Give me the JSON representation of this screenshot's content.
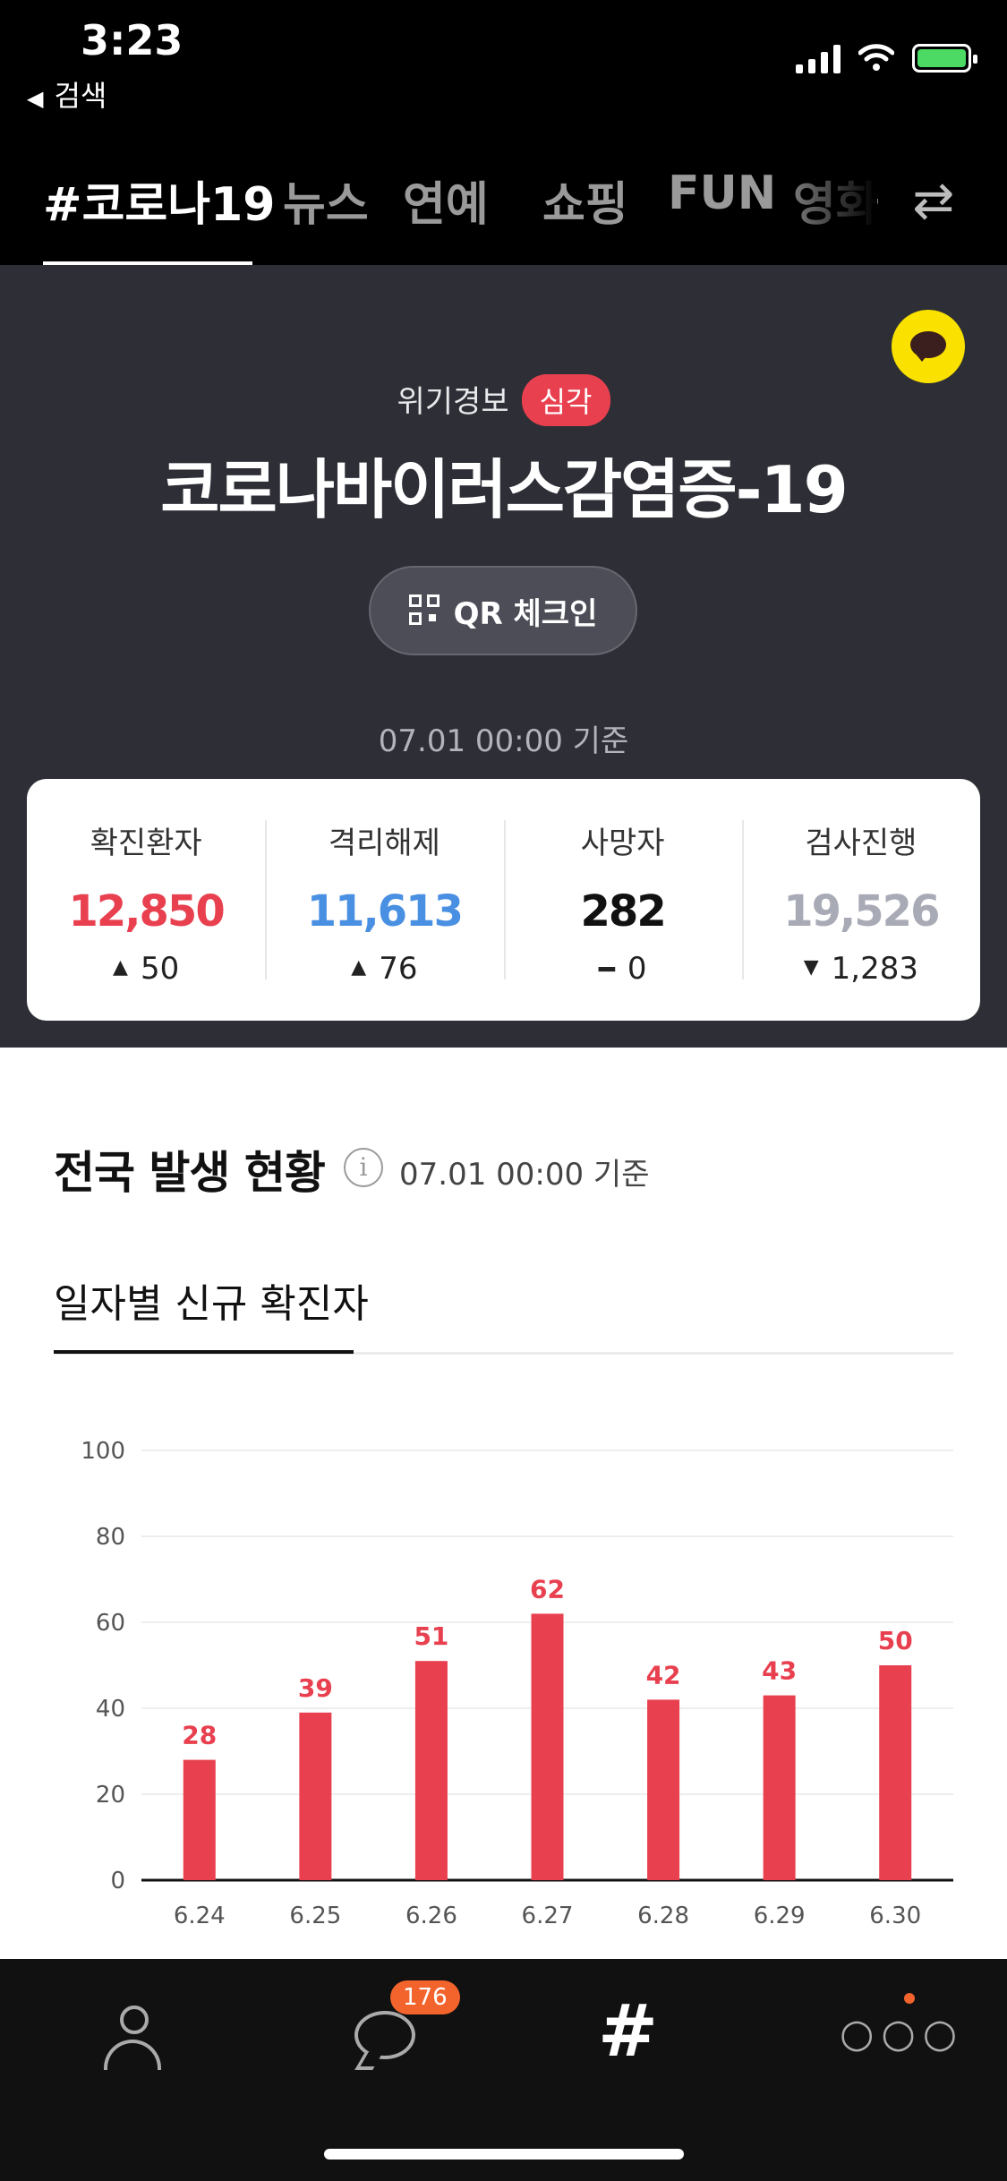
{
  "status_bar": {
    "time": "3:23",
    "back_label": "검색"
  },
  "tabs": [
    {
      "label": "#코로나19",
      "active": true
    },
    {
      "label": "뉴스",
      "active": false
    },
    {
      "label": "연예",
      "active": false
    },
    {
      "label": "쇼핑",
      "active": false
    },
    {
      "label": "FUN",
      "active": false
    },
    {
      "label": "영화",
      "active": false
    }
  ],
  "hero": {
    "alert_label": "위기경보",
    "alert_level": "심각",
    "title": "코로나바이러스감염증-19",
    "qr_button": "QR 체크인",
    "timestamp": "07.01 00:00 기준"
  },
  "stats": [
    {
      "label": "확진환자",
      "value": "12,850",
      "change": "50",
      "direction": "up",
      "color": "#e8404f"
    },
    {
      "label": "격리해제",
      "value": "11,613",
      "change": "76",
      "direction": "up",
      "color": "#4a90e2"
    },
    {
      "label": "사망자",
      "value": "282",
      "change": "0",
      "direction": "flat",
      "color": "#111111"
    },
    {
      "label": "검사진행",
      "value": "19,526",
      "change": "1,283",
      "direction": "down",
      "color": "#a8aab6"
    }
  ],
  "section": {
    "title": "전국 발생 현황",
    "timestamp": "07.01 00:00 기준",
    "sub_tab": "일자별 신규 확진자"
  },
  "chart_data": {
    "type": "bar",
    "categories": [
      "6.24",
      "6.25",
      "6.26",
      "6.27",
      "6.28",
      "6.29",
      "6.30"
    ],
    "values": [
      28,
      39,
      51,
      62,
      42,
      43,
      50
    ],
    "yticks": [
      0,
      20,
      40,
      60,
      80,
      100
    ],
    "ylim": [
      0,
      100
    ],
    "grid": true,
    "bar_color": "#e8404f"
  },
  "bottom_nav": {
    "chat_badge": "176"
  },
  "colors": {
    "accent": "#e8404f",
    "hero_bg": "#2e2f36",
    "kakao": "#fae100"
  }
}
